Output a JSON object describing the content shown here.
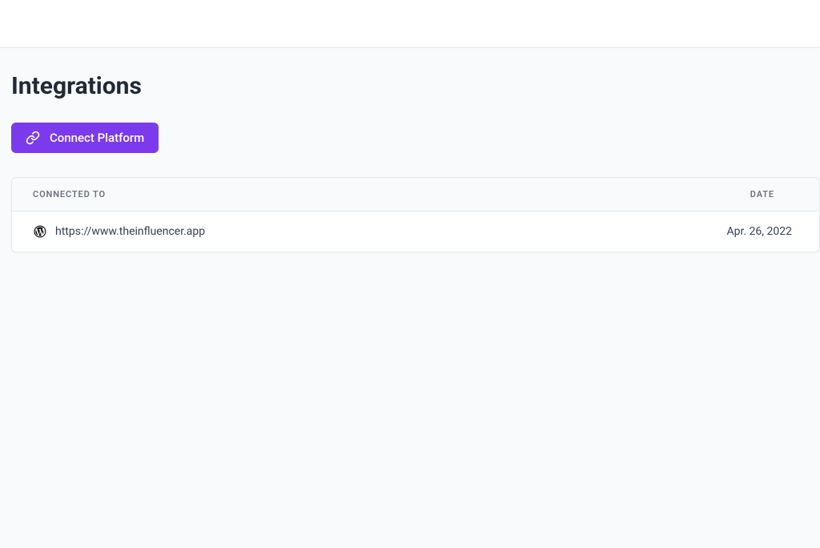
{
  "page": {
    "title": "Integrations"
  },
  "actions": {
    "connect_label": "Connect Platform"
  },
  "table": {
    "headers": {
      "connected_to": "CONNECTED TO",
      "date": "DATE"
    },
    "rows": [
      {
        "icon": "wordpress",
        "url": "https://www.theinfluencer.app",
        "date": "Apr. 26, 2022"
      }
    ]
  }
}
